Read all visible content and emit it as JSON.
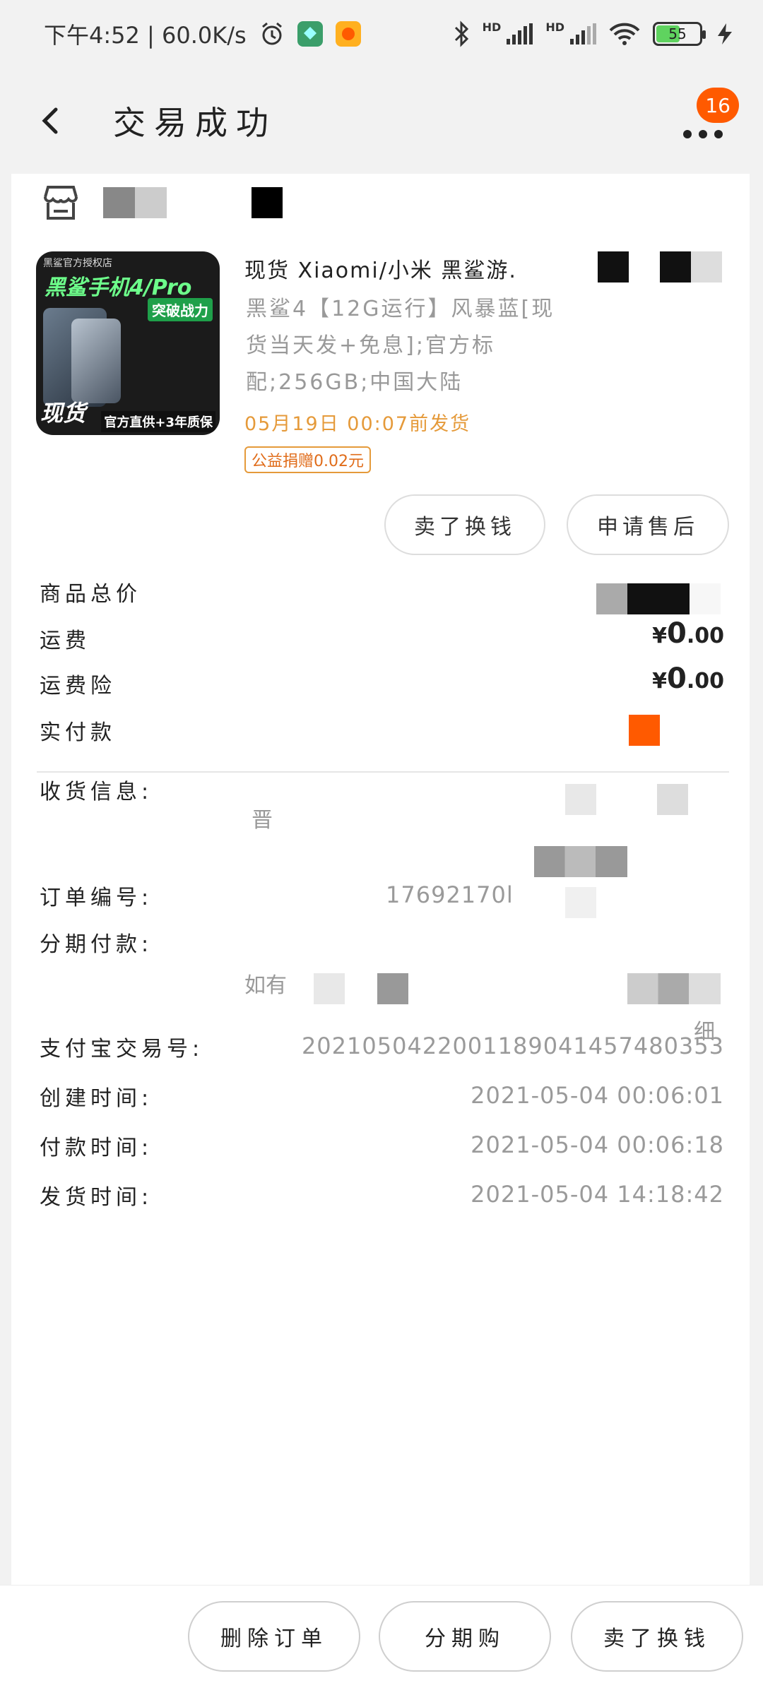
{
  "status_bar": {
    "time_speed": "下午4:52 | 60.0K/s",
    "battery": "55",
    "hd1": "HD",
    "hd2": "HD"
  },
  "header": {
    "title": "交易成功",
    "badge_count": "16"
  },
  "product": {
    "image_top_text": "黑鲨官方授权店",
    "image_title": "黑鲨手机4/Pro",
    "image_badge": "突破战力",
    "image_stock": "现货",
    "image_bottom": "官方直供+3年质保",
    "title": "现货 Xiaomi/小米 黑鲨游.",
    "spec": "黑鲨4【12G运行】风暴蓝[现货当天发+免息];官方标配;256GB;中国大陆",
    "ship_time": "05月19日 00:07前发货",
    "charity_tag": "公益捐赠0.02元",
    "sell_button": "卖了换钱",
    "after_sale_button": "申请售后"
  },
  "summary": {
    "total_label": "商品总价",
    "shipping_label": "运费",
    "shipping_yen": "¥",
    "shipping_int": "0",
    "shipping_dec": ".00",
    "insurance_label": "运费险",
    "insurance_yen": "¥",
    "insurance_int": "0",
    "insurance_dec": ".00",
    "paid_label": "实付款"
  },
  "details": {
    "receiver_label": "收货信息:",
    "receiver_partial": "晋",
    "order_no_label": "订单编号:",
    "order_no_value": "17692170l",
    "installment_label": "分期付款:",
    "installment_partial": "如有",
    "installment_tail": "细",
    "alipay_label": "支付宝交易号:",
    "alipay_value": "2021050422001189041457480353",
    "created_label": "创建时间:",
    "created_value": "2021-05-04 00:06:01",
    "paid_time_label": "付款时间:",
    "paid_time_value": "2021-05-04 00:06:18",
    "shipped_label": "发货时间:",
    "shipped_value": "2021-05-04 14:18:42"
  },
  "bottom_bar": {
    "delete_order": "删除订单",
    "installment_buy": "分期购",
    "sell": "卖了换钱"
  },
  "colors": {
    "accent": "#ff5a00",
    "ship_time": "#e59a3a"
  }
}
